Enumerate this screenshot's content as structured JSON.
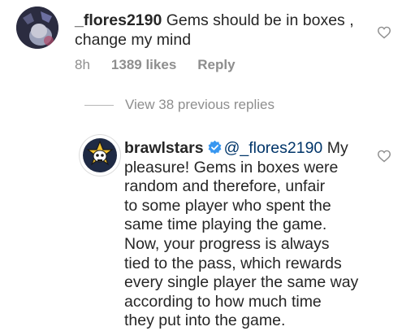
{
  "comment": {
    "username": "_flores2190",
    "text": " Gems should be in boxes ,",
    "text_line2": "change my mind",
    "time": "8h",
    "likes": "1389 likes",
    "reply_label": "Reply"
  },
  "view_replies": "View 38 previous replies",
  "reply": {
    "username": "brawlstars",
    "mention": "@_flores2190",
    "lines": [
      " My",
      "pleasure! Gems in boxes were",
      "random and therefore, unfair",
      "to some player who spent the",
      "same time playing the game.",
      "Now, your progress is always",
      "tied to the pass, which rewards",
      "every single player the same way",
      "according to how much time",
      "they put into the game."
    ]
  },
  "colors": {
    "text": "#262626",
    "muted": "#8e8e8e",
    "verified": "#3897f0",
    "mention": "#003569"
  },
  "icons": [
    "heart-outline-icon",
    "verified-badge-icon",
    "brawlstars-skull-logo"
  ]
}
